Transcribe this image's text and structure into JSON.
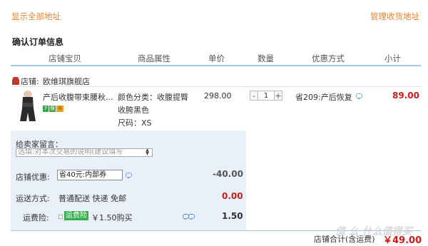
{
  "links": {
    "show_all_address": "显示全部地址",
    "manage_address": "管理收货地址"
  },
  "section_title": "确认订单信息",
  "columns": [
    "店铺宝贝",
    "商品属性",
    "单价",
    "数量",
    "优惠方式",
    "小计"
  ],
  "shop": {
    "label": "店铺:",
    "name": "欧维琪旗舰店"
  },
  "item": {
    "title": "产后收腹带束腰秋...",
    "attr_color": "颜色分类：收腹提臀",
    "attr_color_2": "收胯黑色",
    "attr_size": "尺码：XS",
    "unit_price": "298.00",
    "qty_minus": "-",
    "qty_value": "1",
    "qty_plus": "+",
    "promo": "省209:产后恢复",
    "subtotal": "89.00",
    "badges": [
      "7",
      "保",
      "卡"
    ]
  },
  "message": {
    "label": "给卖家留言：",
    "placeholder": "选填:对本次交易的说明(建议填写"
  },
  "shop_discount": {
    "label": "店铺优惠:",
    "selected": "省40元:内部券",
    "amount": "-40.00"
  },
  "shipping": {
    "label": "运送方式:",
    "value": "普通配送 快递 免邮",
    "amount": "0.00"
  },
  "insurance": {
    "label": "运费险:",
    "tag": "运费险",
    "text": "￥1.50购买",
    "amount": "1.50"
  },
  "total": {
    "label": "店铺合计(含运费)",
    "amount": "￥49.00"
  },
  "watermark": "值 么 什么值得买",
  "colors": {
    "accent": "#e4862e",
    "price_red": "#cc1b1b",
    "panel": "#eaf0fa",
    "divider": "#a6c4ea"
  }
}
